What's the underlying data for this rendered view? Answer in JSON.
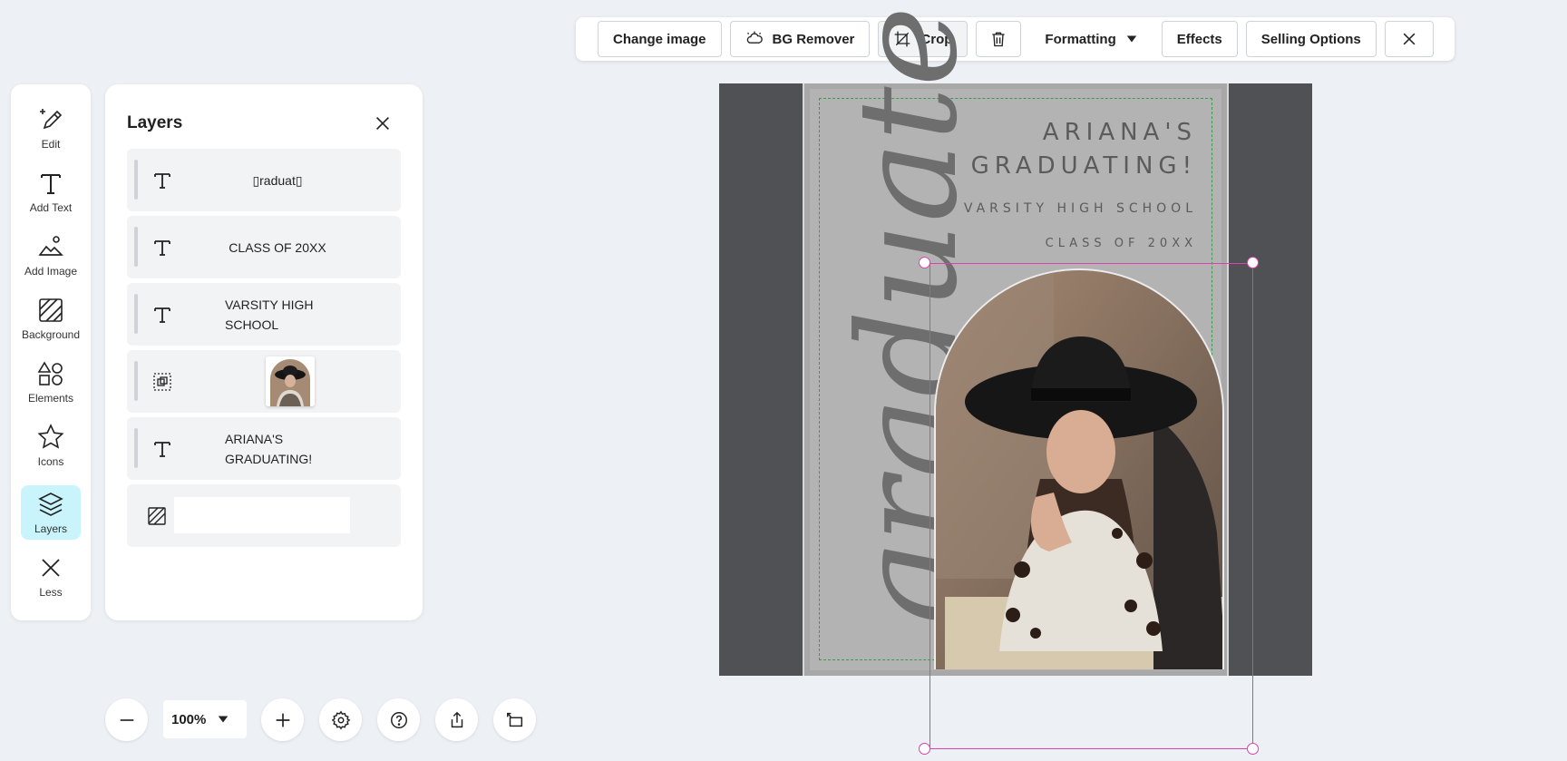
{
  "toolbar": {
    "change_image": "Change image",
    "bg_remover": "BG Remover",
    "crop": "Crop",
    "formatting": "Formatting",
    "effects": "Effects",
    "selling_options": "Selling Options"
  },
  "rail": {
    "items": [
      {
        "label": "Edit",
        "icon": "magic-pencil-icon"
      },
      {
        "label": "Add Text",
        "icon": "text-t-icon"
      },
      {
        "label": "Add Image",
        "icon": "image-add-icon"
      },
      {
        "label": "Background",
        "icon": "background-icon"
      },
      {
        "label": "Elements",
        "icon": "shapes-icon"
      },
      {
        "label": "Icons",
        "icon": "star-icon"
      },
      {
        "label": "Layers",
        "icon": "layers-icon",
        "active": true
      },
      {
        "label": "Less",
        "icon": "close-icon"
      }
    ]
  },
  "layers_panel": {
    "title": "Layers",
    "layers": [
      {
        "type": "text",
        "text": "▯raduat▯"
      },
      {
        "type": "text",
        "text": "CLASS OF 20XX"
      },
      {
        "type": "text",
        "line1": "VARSITY HIGH",
        "line2": "SCHOOL"
      },
      {
        "type": "image"
      },
      {
        "type": "text",
        "line1": "ARIANA'S",
        "line2": "GRADUATING!"
      },
      {
        "type": "background"
      }
    ]
  },
  "zoom": {
    "value": "100%"
  },
  "canvas": {
    "title_line1": "ARIANA'S",
    "title_line2": "GRADUATING!",
    "school": "VARSITY HIGH SCHOOL",
    "class_of": "CLASS OF 20XX",
    "script_word": "graduate"
  },
  "colors": {
    "accent_active": "#c9f4fb",
    "selection": "#e03fb0",
    "safe_area": "#3a9b4f",
    "canvas_bg": "#505154",
    "card_bg": "#b3b3b3"
  }
}
